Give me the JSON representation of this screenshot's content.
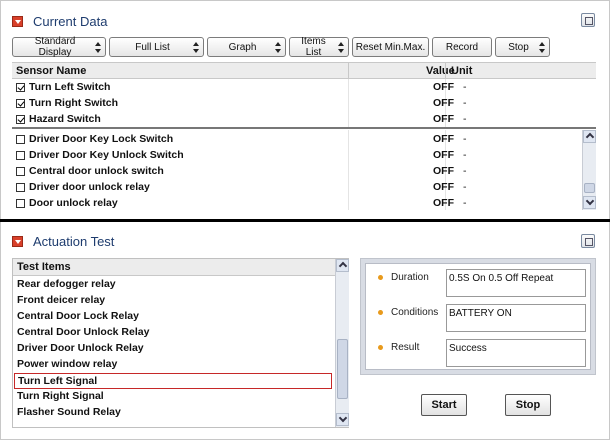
{
  "current_data": {
    "title": "Current Data",
    "toolbar": {
      "display_mode": "Standard Display",
      "list_mode": "Full List",
      "graph": "Graph",
      "items_list": "Items List",
      "reset": "Reset Min.Max.",
      "record": "Record",
      "stop": "Stop"
    },
    "table": {
      "columns": [
        "Sensor Name",
        "Value",
        "Unit"
      ],
      "selected_rows": [
        {
          "name": "Turn Left Switch",
          "value": "OFF",
          "unit": "-",
          "checked": true
        },
        {
          "name": "Turn Right Switch",
          "value": "OFF",
          "unit": "-",
          "checked": true
        },
        {
          "name": "Hazard Switch",
          "value": "OFF",
          "unit": "-",
          "checked": true
        }
      ],
      "other_rows": [
        {
          "name": "Driver Door Key Lock Switch",
          "value": "OFF",
          "unit": "-",
          "checked": false
        },
        {
          "name": "Driver Door Key Unlock Switch",
          "value": "OFF",
          "unit": "-",
          "checked": false
        },
        {
          "name": "Central door unlock switch",
          "value": "OFF",
          "unit": "-",
          "checked": false
        },
        {
          "name": "Driver door unlock relay",
          "value": "OFF",
          "unit": "-",
          "checked": false
        },
        {
          "name": "Door unlock relay",
          "value": "OFF",
          "unit": "-",
          "checked": false
        }
      ]
    }
  },
  "actuation_test": {
    "title": "Actuation Test",
    "list_header": "Test Items",
    "items": [
      "Rear defogger relay",
      "Front deicer relay",
      "Central Door Lock Relay",
      "Central Door Unlock Relay",
      "Driver Door Unlock Relay",
      "Power window relay",
      "Turn Left Signal",
      "Turn Right Signal",
      "Flasher Sound Relay"
    ],
    "selected_item": "Turn Left Signal",
    "details": {
      "duration_label": "Duration",
      "duration_value": "0.5S On 0.5 Off Repeat",
      "conditions_label": "Conditions",
      "conditions_value": "BATTERY ON",
      "result_label": "Result",
      "result_value": "Success"
    },
    "start_label": "Start",
    "stop_label": "Stop"
  },
  "colors": {
    "collapse_red": "#d8402a",
    "title_blue": "#1e3c6e",
    "bullet_orange": "#e89a1c",
    "selection_border": "#c62828"
  }
}
